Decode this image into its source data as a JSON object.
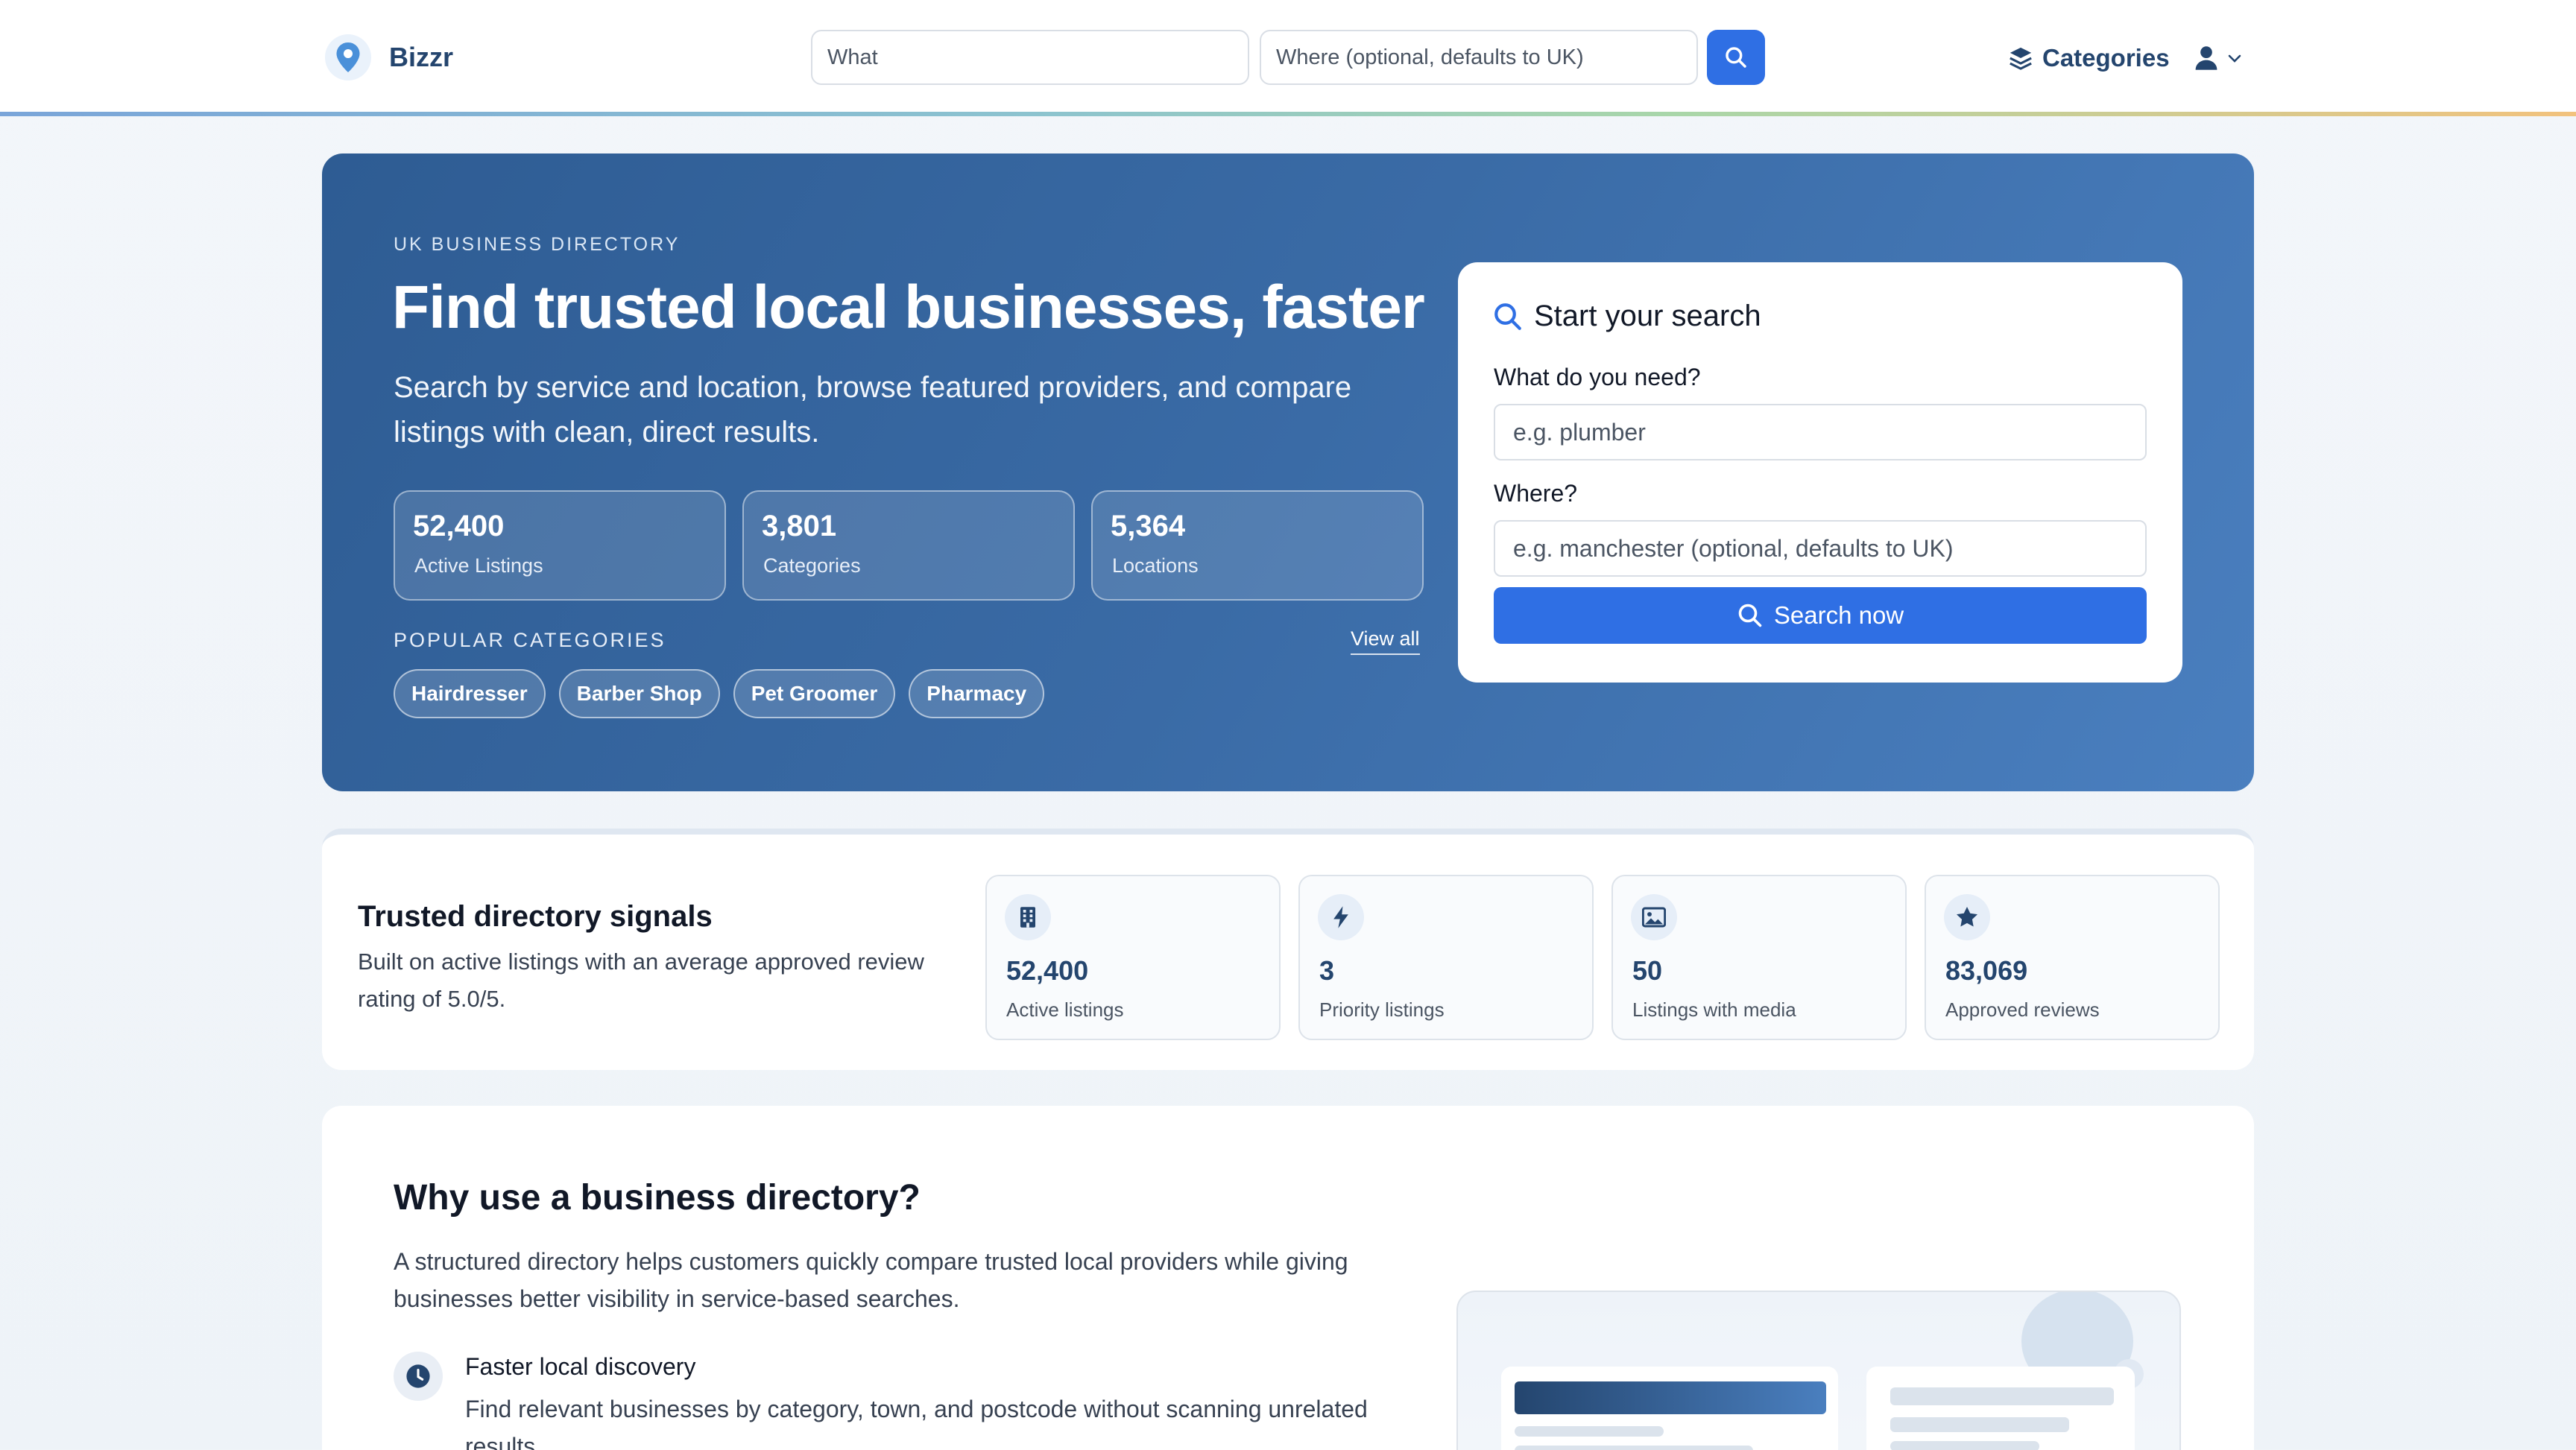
{
  "nav": {
    "brand": "Bizzr",
    "what_placeholder": "What",
    "where_placeholder": "Where (optional, defaults to UK)",
    "categories_label": "Categories"
  },
  "hero": {
    "kicker": "UK BUSINESS DIRECTORY",
    "title": "Find trusted local businesses, faster",
    "subtitle": "Search by service and location, browse featured providers, and compare listings with clean, direct results.",
    "stats": [
      {
        "value": "52,400",
        "label": "Active Listings"
      },
      {
        "value": "3,801",
        "label": "Categories"
      },
      {
        "value": "5,364",
        "label": "Locations"
      }
    ],
    "popular_label": "POPULAR CATEGORIES",
    "view_all": "View all",
    "chips": [
      "Hairdresser",
      "Barber Shop",
      "Pet Groomer",
      "Pharmacy"
    ]
  },
  "search_card": {
    "title": "Start your search",
    "what_label": "What do you need?",
    "what_placeholder": "e.g. plumber",
    "where_label": "Where?",
    "where_placeholder": "e.g. manchester (optional, defaults to UK)",
    "button": "Search now"
  },
  "signals": {
    "title": "Trusted directory signals",
    "description": "Built on active listings with an average approved review rating of 5.0/5.",
    "cards": [
      {
        "icon": "building-icon",
        "value": "52,400",
        "label": "Active listings"
      },
      {
        "icon": "lightning-icon",
        "value": "3",
        "label": "Priority listings"
      },
      {
        "icon": "image-icon",
        "value": "50",
        "label": "Listings with media"
      },
      {
        "icon": "star-icon",
        "value": "83,069",
        "label": "Approved reviews"
      }
    ]
  },
  "why": {
    "title": "Why use a business directory?",
    "description": "A structured directory helps customers quickly compare trusted local providers while giving businesses better visibility in service-based searches.",
    "feature_title": "Faster local discovery",
    "feature_desc": "Find relevant businesses by category, town, and postcode without scanning unrelated results."
  },
  "colors": {
    "accent": "#2f6fe4",
    "brand": "#24456e",
    "hero_start": "#2e5c93",
    "hero_end": "#4a7fbf"
  }
}
